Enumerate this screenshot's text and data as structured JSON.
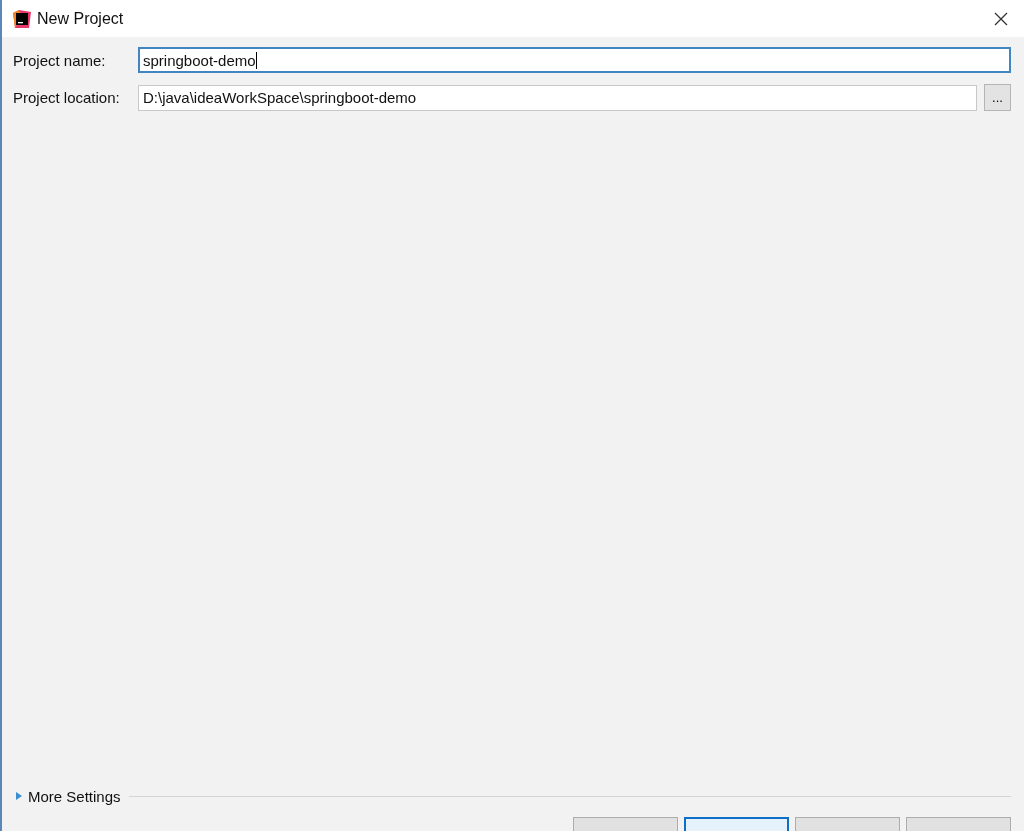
{
  "window": {
    "title": "New Project"
  },
  "fields": [
    {
      "label": "Project name:",
      "value": "springboot-demo",
      "focused": true
    },
    {
      "label": "Project location:",
      "value": "D:\\java\\ideaWorkSpace\\springboot-demo",
      "focused": false,
      "browse_label": "..."
    }
  ],
  "more_settings": {
    "label": "More Settings",
    "expanded": false
  },
  "buttons": [
    {
      "focused": false
    },
    {
      "focused": true
    },
    {
      "focused": false
    },
    {
      "focused": false
    }
  ]
}
